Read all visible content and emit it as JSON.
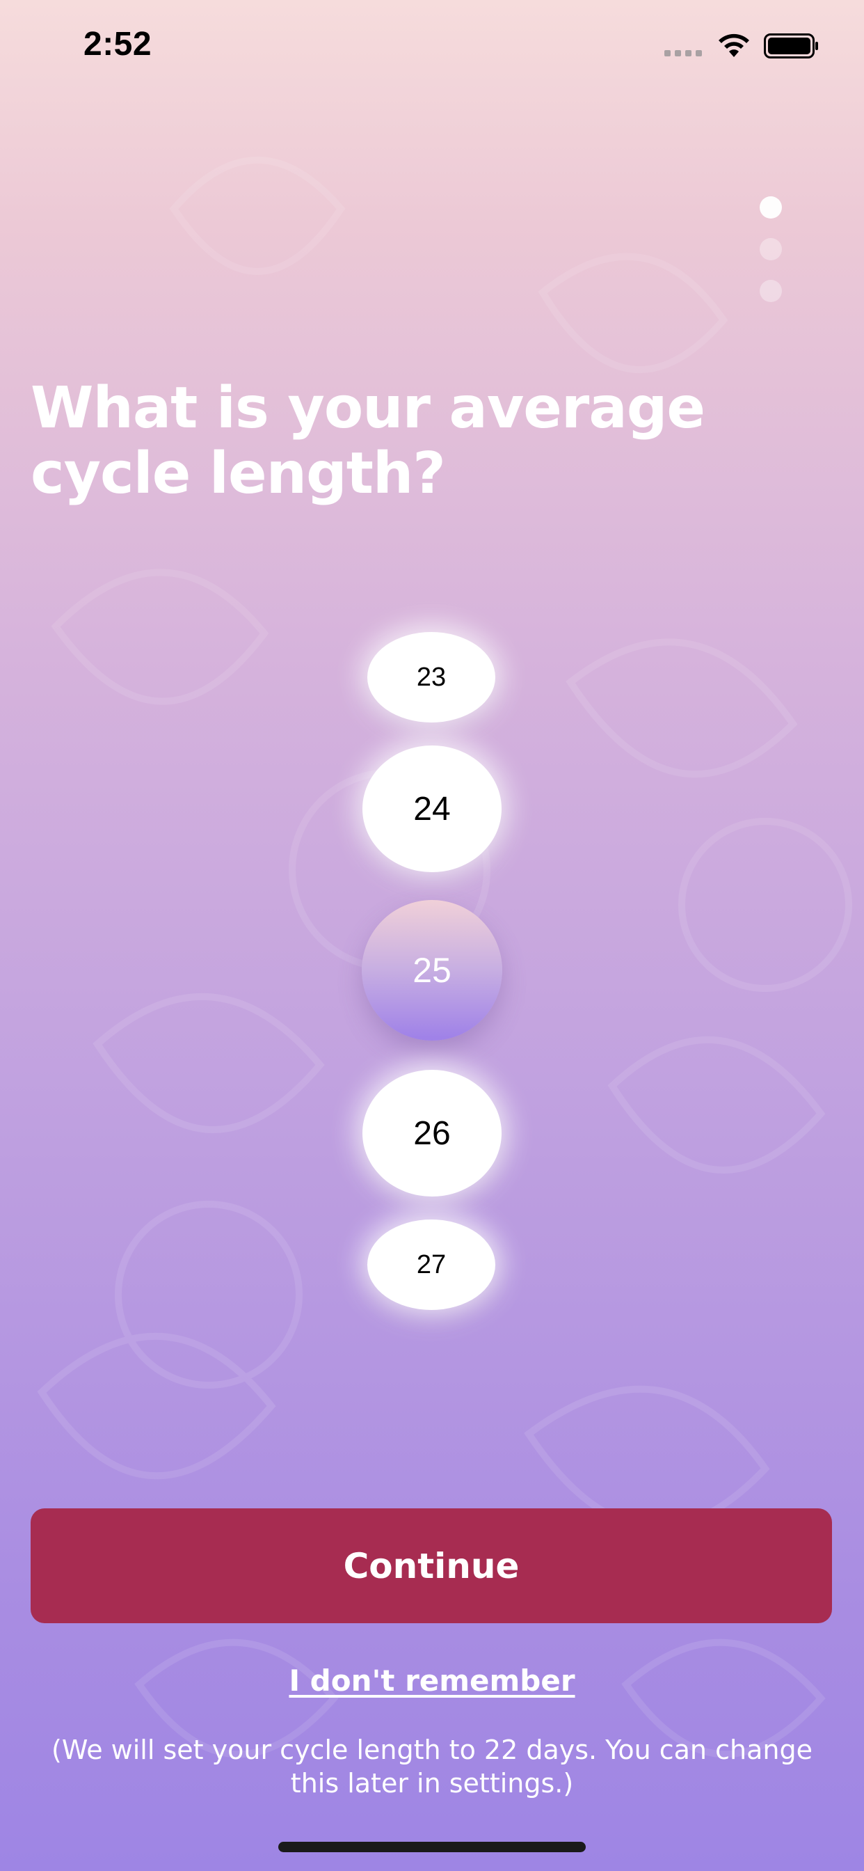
{
  "status_bar": {
    "time": "2:52",
    "icons": [
      "cellular-signal-icon",
      "wifi-icon",
      "battery-icon"
    ]
  },
  "pager": {
    "total": 3,
    "active_index": 0
  },
  "title": "What is your average cycle length?",
  "picker": {
    "options": [
      "23",
      "24",
      "25",
      "26",
      "27"
    ],
    "selected": "25"
  },
  "continue_label": "Continue",
  "dont_remember_label": "I don't remember",
  "note": "(We will set your cycle length to 22 days. You can change this later in settings.)",
  "colors": {
    "primary_button": "#a72c51",
    "gradient_top": "#f6dcdc",
    "gradient_bottom": "#9e85e4",
    "selected_accent": "#9e80e8"
  }
}
